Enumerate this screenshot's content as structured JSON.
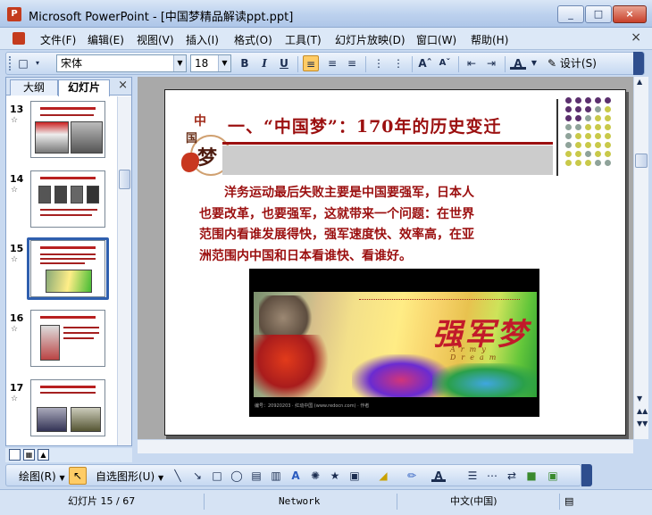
{
  "window": {
    "title": "Microsoft PowerPoint - [中国梦精品解读ppt.ppt]",
    "app_icon": "P",
    "minimize": "_",
    "maximize": "□",
    "close": "×"
  },
  "menu": {
    "items": [
      "文件(F)",
      "编辑(E)",
      "视图(V)",
      "插入(I)",
      "格式(O)",
      "工具(T)",
      "幻灯片放映(D)",
      "窗口(W)",
      "帮助(H)"
    ],
    "close_doc": "×"
  },
  "format_toolbar": {
    "font_name": "宋体",
    "font_size": "18",
    "bold": "B",
    "italic": "I",
    "underline": "U",
    "design_label": "设计(S)"
  },
  "outline_pane": {
    "tabs": [
      "大纲",
      "幻灯片"
    ],
    "active_tab": "幻灯片",
    "close": "×",
    "thumbnails": [
      {
        "number": "13",
        "star": "☆"
      },
      {
        "number": "14",
        "star": "☆"
      },
      {
        "number": "15",
        "star": "☆",
        "selected": true
      },
      {
        "number": "16",
        "star": "☆"
      },
      {
        "number": "17",
        "star": "☆"
      }
    ]
  },
  "slide": {
    "logo_chars": [
      "中",
      "国",
      "梦"
    ],
    "title": "一、“中国梦”：170年的历史变迁",
    "body_lines": [
      "洋务运动最后失败主要是中国要强军，日本人",
      "也要改革，也要强军，这就带来一个问题：在世界",
      "范围内看谁发展得快，强军速度快、效率高，在亚",
      "洲范围内中国和日本看谁快、看谁好。"
    ],
    "poster": {
      "main_text": "强军梦",
      "sub_text": "Army Dream",
      "caption": "编号：20920203 · 红动中国 (www.redocn.com) · 作者"
    },
    "dot_colors": [
      "#5b2f6e",
      "#8fa39a",
      "#c9c94a"
    ]
  },
  "drawing_toolbar": {
    "draw_label": "绘图(R)",
    "autoshapes_label": "自选图形(U)"
  },
  "status_bar": {
    "slide_position": "幻灯片 15 / 67",
    "design_template": "Network",
    "language": "中文(中国)"
  }
}
